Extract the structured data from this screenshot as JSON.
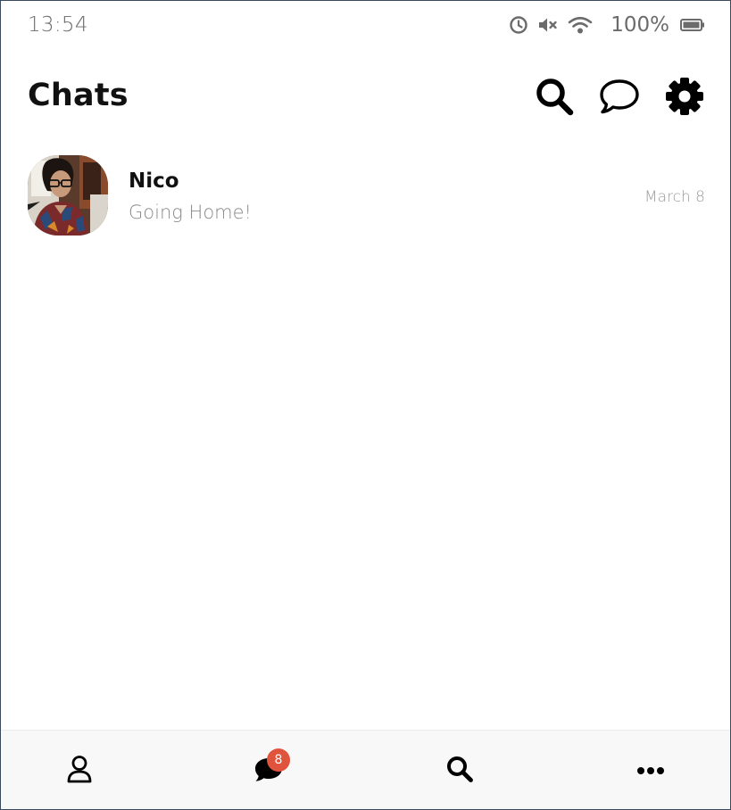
{
  "status_bar": {
    "time": "13:54",
    "icons": [
      "alarm-icon",
      "mute-icon",
      "wifi-icon"
    ],
    "battery_percent": "100%"
  },
  "header": {
    "title": "Chats",
    "actions": [
      "search-icon",
      "new-chat-icon",
      "settings-icon"
    ]
  },
  "chats": [
    {
      "name": "Nico",
      "preview": "Going Home!",
      "date": "March 8"
    }
  ],
  "bottom_nav": {
    "items": [
      "profile-icon",
      "chats-icon",
      "search-icon",
      "more-icon"
    ],
    "chats_badge": "8"
  },
  "colors": {
    "badge": "#e0533c",
    "nav_background": "#f8f8f8",
    "text_primary": "#111111",
    "text_secondary": "#8a8a8a"
  }
}
